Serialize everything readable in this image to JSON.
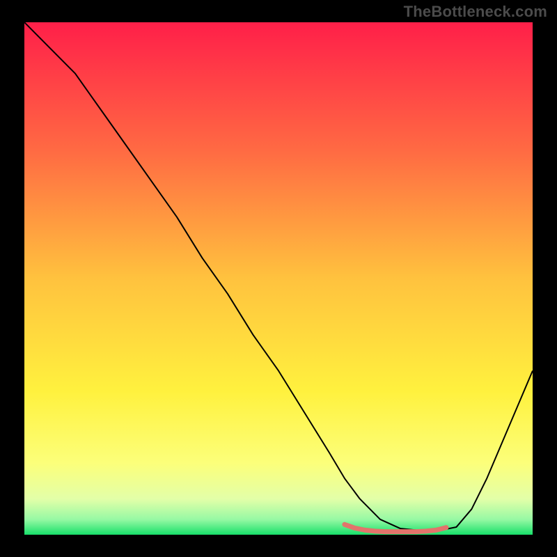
{
  "watermark": "TheBottleneck.com",
  "chart_data": {
    "type": "line",
    "title": "",
    "xlabel": "",
    "ylabel": "",
    "xlim": [
      0,
      100
    ],
    "ylim": [
      0,
      100
    ],
    "grid": false,
    "legend": false,
    "background": {
      "gradient_type": "vertical",
      "stops": [
        {
          "offset": 0.0,
          "color": "#ff1f49"
        },
        {
          "offset": 0.25,
          "color": "#ff6a43"
        },
        {
          "offset": 0.5,
          "color": "#ffc23e"
        },
        {
          "offset": 0.72,
          "color": "#fff13e"
        },
        {
          "offset": 0.86,
          "color": "#fcff7a"
        },
        {
          "offset": 0.93,
          "color": "#e3ffa8"
        },
        {
          "offset": 0.97,
          "color": "#97f9a4"
        },
        {
          "offset": 1.0,
          "color": "#18e06a"
        }
      ]
    },
    "series": [
      {
        "name": "bottleneck-curve",
        "color": "#000000",
        "stroke_width": 2,
        "x": [
          0,
          5,
          10,
          15,
          20,
          25,
          30,
          35,
          40,
          45,
          50,
          55,
          60,
          63,
          66,
          70,
          74,
          78,
          80,
          82,
          85,
          88,
          91,
          94,
          97,
          100
        ],
        "y": [
          100,
          95,
          90,
          83,
          76,
          69,
          62,
          54,
          47,
          39,
          32,
          24,
          16,
          11,
          7,
          3,
          1.2,
          0.8,
          0.7,
          0.9,
          1.5,
          5,
          11,
          18,
          25,
          32
        ]
      },
      {
        "name": "optimal-range-marker",
        "color": "#e2746b",
        "stroke_width": 7,
        "stroke_linecap": "round",
        "x": [
          63,
          65,
          67,
          69,
          71,
          73,
          75,
          77,
          79,
          81,
          83
        ],
        "y": [
          2.0,
          1.3,
          0.9,
          0.7,
          0.6,
          0.6,
          0.6,
          0.6,
          0.7,
          0.9,
          1.4
        ]
      }
    ]
  }
}
